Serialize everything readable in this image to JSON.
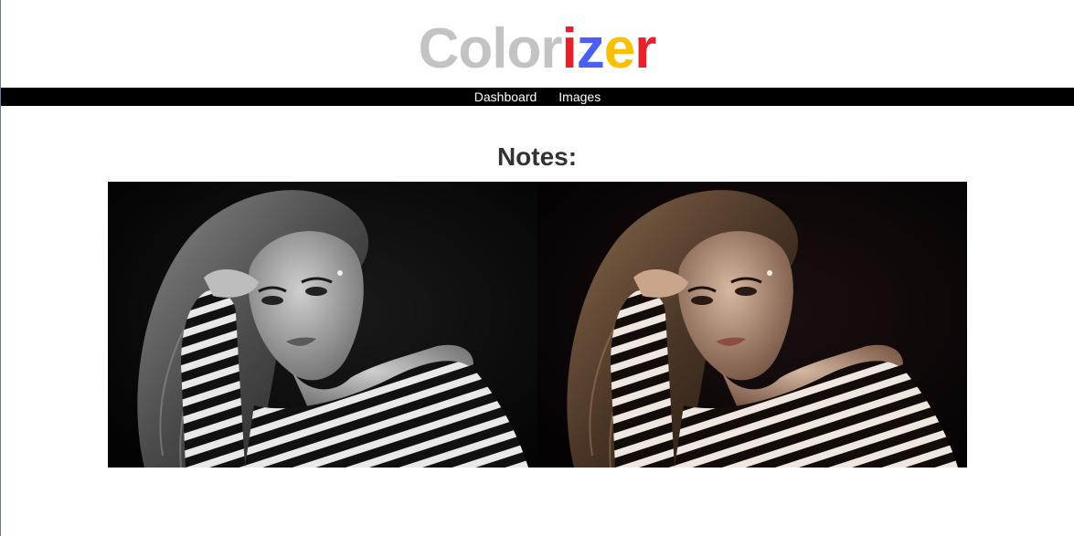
{
  "logo": {
    "parts": [
      {
        "text": "Color",
        "color": "#c3c3c3"
      },
      {
        "text": "i",
        "color": "#e8202c"
      },
      {
        "text": "z",
        "color": "#4b5ef5"
      },
      {
        "text": "e",
        "color": "#f7c000"
      },
      {
        "text": "r",
        "color": "#e8202c"
      }
    ]
  },
  "nav": {
    "items": [
      {
        "label": "Dashboard"
      },
      {
        "label": "Images"
      }
    ]
  },
  "main": {
    "heading": "Notes:",
    "image": {
      "left_panel": "grayscale",
      "right_panel": "colorized"
    }
  }
}
